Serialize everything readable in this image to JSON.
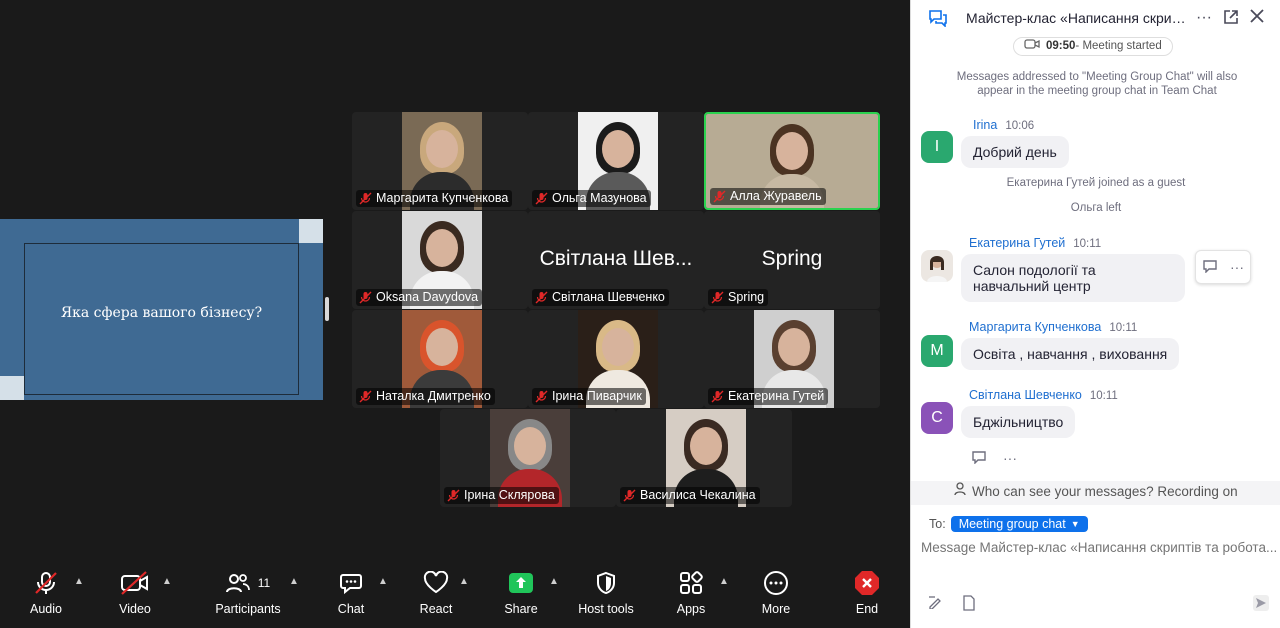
{
  "slide": {
    "text": "Яка сфера вашого бізнесу?"
  },
  "gallery": {
    "participants": [
      {
        "name": "Маргарита Купченкова",
        "video": true,
        "photo": {
          "hair": "#c9a87c",
          "body": "#2c2c2c",
          "bg": "#7a6a55"
        }
      },
      {
        "name": "Ольга Мазунова",
        "video": true,
        "photo": {
          "hair": "#1b1b1b",
          "body": "#5a5a5a",
          "bg": "#f0f0f0"
        }
      },
      {
        "name": "Алла Журавель",
        "video": true,
        "active": true,
        "photo": {
          "hair": "#4b3322",
          "body": "#c7b9a3",
          "bg": "#b7ab94"
        }
      },
      {
        "name": "Oksana Davydova",
        "video": true,
        "photo": {
          "hair": "#3a2a20",
          "body": "#f2f2f2",
          "bg": "#d9d9d9"
        }
      },
      {
        "name": "Світлана Шевченко",
        "video": false,
        "display": "Світлана Шев..."
      },
      {
        "name": "Spring",
        "video": false,
        "display": "Spring"
      },
      {
        "name": "Наталка Дмитренко",
        "video": true,
        "photo": {
          "hair": "#d9542c",
          "body": "#3b3b3b",
          "bg": "#a05a3a"
        }
      },
      {
        "name": "Ірина Пиварчик",
        "video": true,
        "photo": {
          "hair": "#d9b987",
          "body": "#efe9e0",
          "bg": "#2a1f18"
        }
      },
      {
        "name": "Екатерина Гутей",
        "video": true,
        "photo": {
          "hair": "#5a4030",
          "body": "#e8e8e8",
          "bg": "#cfcfcf"
        }
      },
      {
        "name": "Ірина Склярова",
        "video": true,
        "photo": {
          "hair": "#888888",
          "body": "#b3262a",
          "bg": "#4a3e3a"
        }
      },
      {
        "name": "Василиса Чекалина",
        "video": true,
        "photo": {
          "hair": "#3a2a22",
          "body": "#1e1e1e",
          "bg": "#d6cdc4"
        }
      }
    ]
  },
  "toolbar": {
    "audio": "Audio",
    "video": "Video",
    "participants": "Participants",
    "participants_count": "11",
    "chat": "Chat",
    "react": "React",
    "share": "Share",
    "host_tools": "Host tools",
    "apps": "Apps",
    "more": "More",
    "end": "End"
  },
  "chat": {
    "title": "Майстер-клас «Написання скрипт...",
    "meeting_started_time": "09:50",
    "meeting_started_text": " - Meeting started",
    "notice": "Messages addressed to \"Meeting Group Chat\" will also appear in the meeting group chat in Team Chat",
    "messages": [
      {
        "sender": "Irina",
        "time": "10:06",
        "initial": "I",
        "color": "#2aa86f",
        "text": "Добрий день"
      },
      {
        "sender": "Екатерина Гутей",
        "time": "10:11",
        "text": "Салон подології та навчальний центр"
      },
      {
        "sender": "Маргарита Купченкова",
        "time": "10:11",
        "initial": "M",
        "color": "#2aa86f",
        "text": "Освіта , навчання , виховання"
      },
      {
        "sender": "Світлана Шевченко",
        "time": "10:11",
        "initial": "C",
        "color": "#8a52b8",
        "text": "Бджільництво"
      }
    ],
    "system": [
      "Екатерина Гутей joined as a guest",
      "Ольга left"
    ],
    "who_can_see": "Who can see your messages? Recording on",
    "to_label": "To:",
    "to_target": "Meeting group chat",
    "input_placeholder": "Message Майстер-клас «Написання скриптів та робота..."
  }
}
